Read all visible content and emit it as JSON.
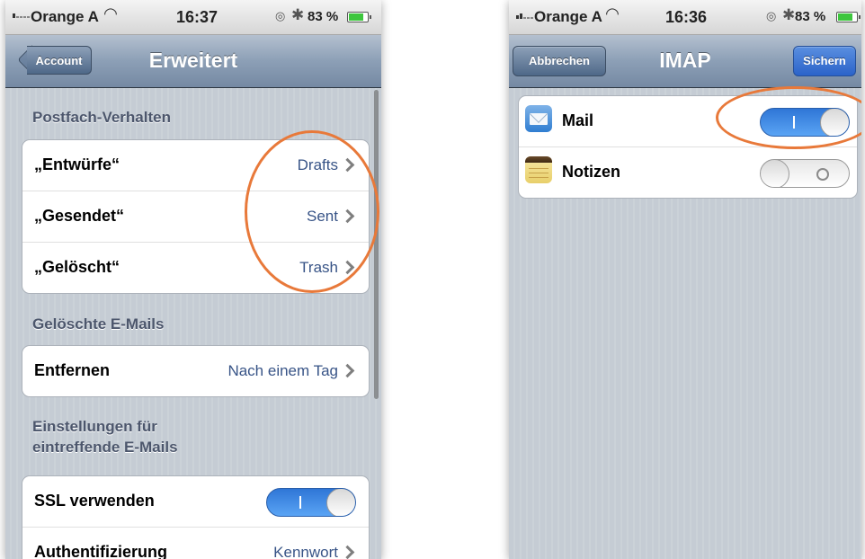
{
  "left_screen": {
    "status": {
      "carrier": "Orange A",
      "time": "16:37",
      "battery_pct": "83 %"
    },
    "nav": {
      "back_label": "Account",
      "title": "Erweitert"
    },
    "sections": [
      {
        "header": "Postfach-Verhalten",
        "rows": [
          {
            "label": "„Entwürfe“",
            "value": "Drafts"
          },
          {
            "label": "„Gesendet“",
            "value": "Sent"
          },
          {
            "label": "„Gelöscht“",
            "value": "Trash"
          }
        ]
      },
      {
        "header": "Gelöschte E-Mails",
        "rows": [
          {
            "label": "Entfernen",
            "value": "Nach einem Tag"
          }
        ]
      },
      {
        "header": "Einstellungen für eintreffende E-Mails",
        "rows": [
          {
            "label": "SSL verwenden",
            "toggle": "on"
          },
          {
            "label": "Authentifizierung",
            "value": "Kennwort"
          }
        ]
      }
    ]
  },
  "right_screen": {
    "status": {
      "carrier": "Orange A",
      "time": "16:36",
      "battery_pct": "83 %"
    },
    "nav": {
      "cancel_label": "Abbrechen",
      "title": "IMAP",
      "save_label": "Sichern"
    },
    "rows": [
      {
        "label": "Mail",
        "icon": "mail-icon",
        "toggle": "on"
      },
      {
        "label": "Notizen",
        "icon": "notes-icon",
        "toggle": "off"
      }
    ]
  },
  "colors": {
    "highlight": "#e8793a",
    "value_text": "#385487",
    "section_header": "#4c566c",
    "toggle_on": "#2f76d6"
  }
}
